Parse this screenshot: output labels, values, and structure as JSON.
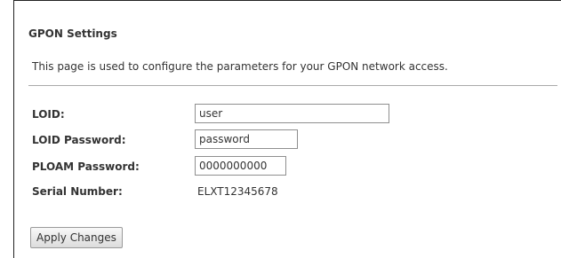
{
  "page": {
    "title": "GPON Settings",
    "description": "This page is used to configure the parameters for your GPON network access."
  },
  "form": {
    "loid": {
      "label": "LOID:",
      "value": "user"
    },
    "loid_password": {
      "label": "LOID Password:",
      "value": "password"
    },
    "ploam_password": {
      "label": "PLOAM Password:",
      "value": "0000000000"
    },
    "serial_number": {
      "label": "Serial Number:",
      "value": "ELXT12345678"
    }
  },
  "actions": {
    "apply_label": "Apply Changes"
  },
  "colors": {
    "text": "#333333",
    "divider": "#aaaaaa",
    "frame": "#222222"
  }
}
